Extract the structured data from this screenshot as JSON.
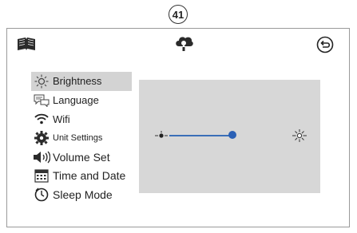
{
  "callout": {
    "number": "41"
  },
  "header": {
    "icons": [
      "book-icon",
      "cloud-bulb-icon",
      "back-icon"
    ]
  },
  "menu": {
    "items": [
      {
        "label": "Brightness",
        "icon": "brightness-icon",
        "active": true
      },
      {
        "label": "Language",
        "icon": "speech-bubble-icon",
        "active": false
      },
      {
        "label": "Wifi",
        "icon": "wifi-icon",
        "active": false
      },
      {
        "label": "Unit Settings",
        "icon": "gear-icon",
        "active": false
      },
      {
        "label": "Volume Set",
        "icon": "speaker-icon",
        "active": false
      },
      {
        "label": "Time and Date",
        "icon": "calendar-icon",
        "active": false
      },
      {
        "label": "Sleep Mode",
        "icon": "clock-icon",
        "active": false
      }
    ]
  },
  "brightness": {
    "level": 0.52
  },
  "colors": {
    "panel": "#d7d7d7",
    "active_item": "#d3d3d3",
    "slider": "#2a60b5"
  }
}
